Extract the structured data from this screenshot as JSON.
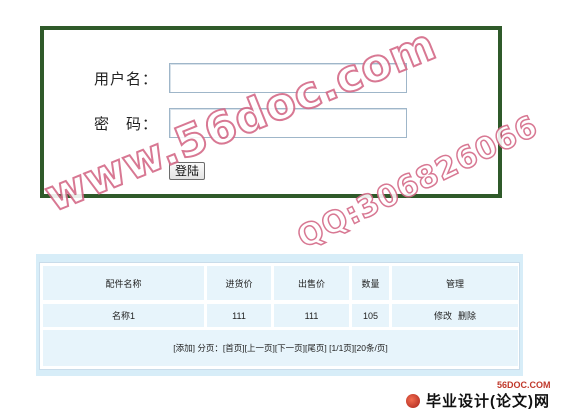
{
  "login": {
    "username_label": "用户名：",
    "password_label": "密　码：",
    "username_value": "",
    "password_value": "",
    "submit_label": "登陆"
  },
  "table": {
    "columns": [
      "配件名称",
      "进货价",
      "出售价",
      "数量",
      "管理"
    ],
    "rows": [
      {
        "name": "名称1",
        "buy_price": "111",
        "sell_price": "111",
        "quantity": "105",
        "edit": "修改",
        "delete": "删除"
      }
    ],
    "footer": "[添加]  分页：[首页][上一页][下一页][尾页]  [1/1页][20条/页]"
  },
  "watermarks": {
    "site": "www.56doc.com",
    "qq": "QQ:306826066"
  },
  "logo": {
    "domain": "56DOC.COM",
    "text": "毕业设计(论文)网",
    "accent": "#c0392b"
  },
  "colors": {
    "panel_border": "#2f5a2a",
    "table_bg": "#d7edf8",
    "cell_bg": "#e7f4fb",
    "watermark": "#d46a88"
  }
}
